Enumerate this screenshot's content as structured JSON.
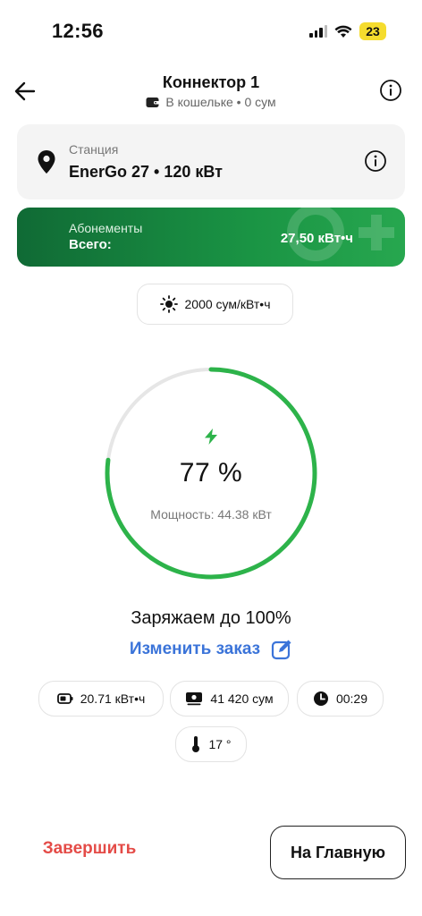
{
  "status_bar": {
    "time": "12:56",
    "battery": "23"
  },
  "header": {
    "title": "Коннектор 1",
    "subtitle": "В кошельке • 0 сум"
  },
  "station": {
    "label": "Станция",
    "name": "EnerGo 27 • 120 кВт"
  },
  "subscriptions": {
    "label": "Абонементы",
    "total_label": "Всего:",
    "total_value": "27,50 кВт•ч"
  },
  "tariff": {
    "text": "2000 сум/кВт•ч"
  },
  "charge": {
    "progress": 0.77,
    "percent_text": "77 %",
    "power_text": "Мощность: 44.38 кВт",
    "target_text": "Заряжаем до 100%",
    "change_order_label": "Изменить заказ"
  },
  "stats": {
    "energy": "20.71 кВт•ч",
    "cost": "41 420 сум",
    "time": "00:29",
    "temperature": "17 °"
  },
  "actions": {
    "finish_label": "Завершить",
    "home_label": "На Главную"
  },
  "colors": {
    "accent_green": "#2db34a",
    "link_blue": "#3b74d9",
    "danger_red": "#e44b47"
  }
}
